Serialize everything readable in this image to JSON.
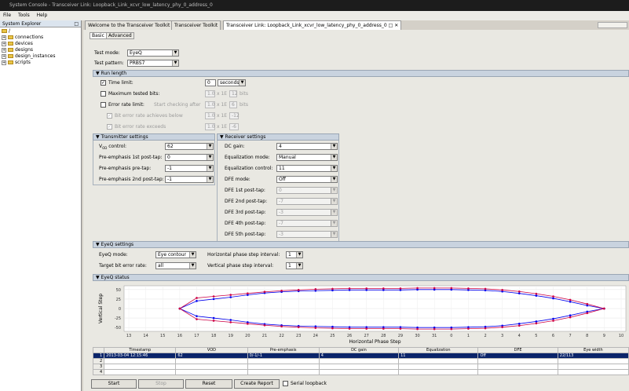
{
  "window": {
    "title": "System Console - Transceiver Link: Loopback_Link_xcvr_low_latency_phy_0_address_0"
  },
  "menu": [
    "File",
    "Tools",
    "Help"
  ],
  "explorer": {
    "title": "System Explorer",
    "root": "/",
    "items": [
      "connections",
      "devices",
      "designs",
      "design_instances",
      "scripts"
    ]
  },
  "tabs": [
    "Welcome to the Transceiver Toolkit",
    "Transceiver Toolkit",
    "Transceiver Link: Loopback_Link_xcvr_low_latency_phy_0_address_0"
  ],
  "subtabs": [
    "Basic",
    "Advanced"
  ],
  "test": {
    "mode_label": "Test mode:",
    "mode_value": "EyeQ",
    "pattern_label": "Test pattern:",
    "pattern_value": "PRBS7"
  },
  "run_length": {
    "header": "Run length",
    "time_limit_label": "Time limit:",
    "time_limit_value": "0",
    "time_unit": "seconds",
    "max_bits_label": "Maximum tested bits:",
    "max_bits_mant": "1.0",
    "max_bits_times": "x 1E",
    "max_bits_exp": "12",
    "max_bits_unit": "bits",
    "err_rate_label": "Error rate limit:",
    "err_rate_note": "Start checking after",
    "err_rate_mant": "1.0",
    "err_rate_times": "x 1E",
    "err_rate_exp": "6",
    "err_rate_unit": "bits",
    "ber_below_label": "Bit error rate achieves below",
    "ber_below_mant": "1.0",
    "ber_below_times": "x 1E",
    "ber_below_exp": "-12",
    "ber_exceeds_label": "Bit error rate exceeds",
    "ber_exceeds_mant": "1.0",
    "ber_exceeds_times": "x 1E",
    "ber_exceeds_exp": "-6"
  },
  "tx": {
    "header": "Transmitter settings",
    "vod_label": "V",
    "vod_sub": "OD",
    "vod_suffix": " control:",
    "vod_value": "62",
    "pe1_label": "Pre-emphasis 1st post-tap:",
    "pe1_value": "0",
    "pre_label": "Pre-emphasis pre-tap:",
    "pre_value": "-1",
    "pe2_label": "Pre-emphasis 2nd post-tap:",
    "pe2_value": "-1"
  },
  "rx": {
    "header": "Receiver settings",
    "dc_label": "DC gain:",
    "dc_value": "4",
    "eqm_label": "Equalization mode:",
    "eqm_value": "Manual",
    "eqc_label": "Equalization control:",
    "eqc_value": "11",
    "dfe_label": "DFE mode:",
    "dfe_value": "Off",
    "dfe1_label": "DFE 1st post-tap:",
    "dfe1_value": "0",
    "dfe2_label": "DFE 2nd post-tap:",
    "dfe2_value": "-7",
    "dfe3_label": "DFE 3rd post-tap:",
    "dfe3_value": "-3",
    "dfe4_label": "DFE 4th post-tap:",
    "dfe4_value": "-7",
    "dfe5_label": "DFE 5th post-tap:",
    "dfe5_value": "-3"
  },
  "eyeq": {
    "header": "EyeQ settings",
    "mode_label": "EyeQ mode:",
    "mode_value": "Eye contour",
    "ber_label": "Target bit error rate:",
    "ber_value": "all",
    "hstep_label": "Horizontal phase step interval:",
    "hstep_value": "1",
    "vstep_label": "Vertical phase step interval:",
    "vstep_value": "1"
  },
  "status": {
    "header": "EyeQ status"
  },
  "chart_data": {
    "type": "line",
    "xlabel": "Horizontal Phase Step",
    "ylabel": "Vertical Step",
    "x_ticks": [
      "13",
      "14",
      "15",
      "16",
      "17",
      "18",
      "19",
      "20",
      "21",
      "22",
      "23",
      "24",
      "25",
      "26",
      "27",
      "28",
      "29",
      "30",
      "31",
      "0",
      "1",
      "2",
      "3",
      "4",
      "5",
      "6",
      "7",
      "8",
      "9",
      "10"
    ],
    "y_ticks": [
      50,
      25,
      0,
      -25,
      -50
    ],
    "ylim": [
      -60,
      60
    ],
    "series": [
      {
        "color": "#0000ee",
        "x": [
          "16",
          "17",
          "18",
          "19",
          "20",
          "21",
          "22",
          "23",
          "24",
          "25",
          "26",
          "27",
          "28",
          "29",
          "30",
          "31",
          "0",
          "1",
          "2",
          "3",
          "4",
          "5",
          "6",
          "7",
          "8",
          "9"
        ],
        "y_top": [
          0,
          20,
          25,
          30,
          36,
          41,
          44,
          46,
          47,
          48,
          49,
          49,
          49,
          49,
          50,
          50,
          50,
          49,
          48,
          45,
          40,
          34,
          27,
          18,
          8,
          0
        ],
        "y_bottom": [
          0,
          -20,
          -25,
          -30,
          -36,
          -41,
          -44,
          -46,
          -47,
          -48,
          -49,
          -49,
          -49,
          -49,
          -50,
          -50,
          -50,
          -49,
          -48,
          -45,
          -40,
          -34,
          -27,
          -18,
          -8,
          0
        ]
      },
      {
        "color": "#cc0044",
        "x": [
          "16",
          "17",
          "18",
          "19",
          "20",
          "21",
          "22",
          "23",
          "24",
          "25",
          "26",
          "27",
          "28",
          "29",
          "30",
          "31",
          "0",
          "1",
          "2",
          "3",
          "4",
          "5",
          "6",
          "7",
          "8",
          "9"
        ],
        "y_top": [
          0,
          28,
          32,
          36,
          40,
          44,
          47,
          49,
          51,
          52,
          53,
          53,
          53,
          53,
          54,
          54,
          54,
          53,
          52,
          49,
          45,
          39,
          32,
          23,
          12,
          0
        ],
        "y_bottom": [
          0,
          -28,
          -32,
          -36,
          -40,
          -44,
          -47,
          -49,
          -51,
          -52,
          -53,
          -53,
          -53,
          -53,
          -54,
          -54,
          -54,
          -53,
          -52,
          -49,
          -45,
          -39,
          -32,
          -23,
          -12,
          0
        ]
      }
    ]
  },
  "table": {
    "headers": [
      "",
      "Timestamp",
      "VOD",
      "Pre-emphasis",
      "DC gain",
      "Equalization",
      "DFE",
      "Eye width"
    ],
    "rows": [
      [
        "1",
        "2013-03-04 12:15:46",
        "62",
        "0/-1/-1",
        "4",
        "11",
        "Off",
        "22/113"
      ],
      [
        "2",
        "",
        "",
        "",
        "",
        "",
        "",
        ""
      ],
      [
        "3",
        "",
        "",
        "",
        "",
        "",
        "",
        ""
      ],
      [
        "4",
        "",
        "",
        "",
        "",
        "",
        "",
        ""
      ]
    ]
  },
  "buttons": {
    "start": "Start",
    "stop": "Stop",
    "reset": "Reset",
    "create_report": "Create Report",
    "serial_loopback": "Serial loopback"
  }
}
